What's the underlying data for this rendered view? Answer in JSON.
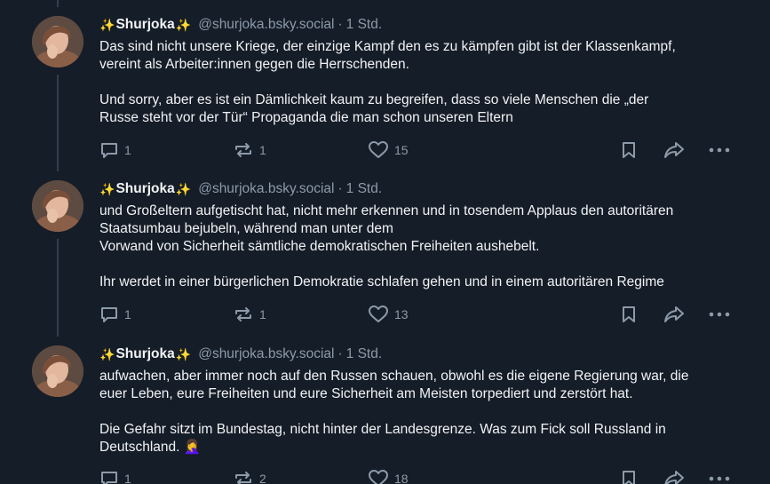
{
  "posts": [
    {
      "sparkle_left": "✨",
      "name": "Shurjoka",
      "sparkle_right": "✨",
      "handle": "@shurjoka.bsky.social",
      "separator": "·",
      "time": "1 Std.",
      "paragraphs": [
        "Das sind nicht unsere Kriege, der einzige Kampf den es zu kämpfen gibt ist der Klassenkampf,\nvereint als Arbeiter:innen gegen die Herrschenden.",
        "Und sorry, aber es ist ein Dämlichkeit kaum zu begreifen, dass so viele Menschen die „der\nRusse steht vor der Tür“ Propaganda die man schon unseren Eltern"
      ],
      "replies": "1",
      "reposts": "1",
      "likes": "15"
    },
    {
      "sparkle_left": "✨",
      "name": "Shurjoka",
      "sparkle_right": "✨",
      "handle": "@shurjoka.bsky.social",
      "separator": "·",
      "time": "1 Std.",
      "paragraphs": [
        "und Großeltern aufgetischt hat, nicht mehr erkennen und in tosendem Applaus den autoritären\nStaatsumbau bejubeln, während man unter dem\nVorwand von Sicherheit sämtliche demokratischen Freiheiten aushebelt.",
        "Ihr werdet in einer bürgerlichen Demokratie schlafen gehen und in einem autoritären Regime"
      ],
      "replies": "1",
      "reposts": "1",
      "likes": "13"
    },
    {
      "sparkle_left": "✨",
      "name": "Shurjoka",
      "sparkle_right": "✨",
      "handle": "@shurjoka.bsky.social",
      "separator": "·",
      "time": "1 Std.",
      "paragraphs": [
        "aufwachen, aber immer noch auf den Russen schauen, obwohl es die eigene Regierung war, die\neuer Leben, eure Freiheiten und eure Sicherheit am Meisten torpediert und zerstört hat.",
        "Die Gefahr sitzt im Bundestag, nicht hinter der Landesgrenze. Was zum Fick soll Russland in\nDeutschland. 🤦‍♀️"
      ],
      "replies": "1",
      "reposts": "2",
      "likes": "18"
    }
  ],
  "icons": {
    "reply": "speech-bubble-icon",
    "repost": "repost-arrows-icon",
    "like": "heart-icon",
    "bookmark": "bookmark-icon",
    "share": "share-arrow-icon",
    "more": "more-dots-icon"
  },
  "colors": {
    "background": "#151d28",
    "text": "#f1f3f5",
    "muted": "#8c9aa9",
    "thread_line": "#2e4052",
    "sparkle": "#f5c242"
  }
}
